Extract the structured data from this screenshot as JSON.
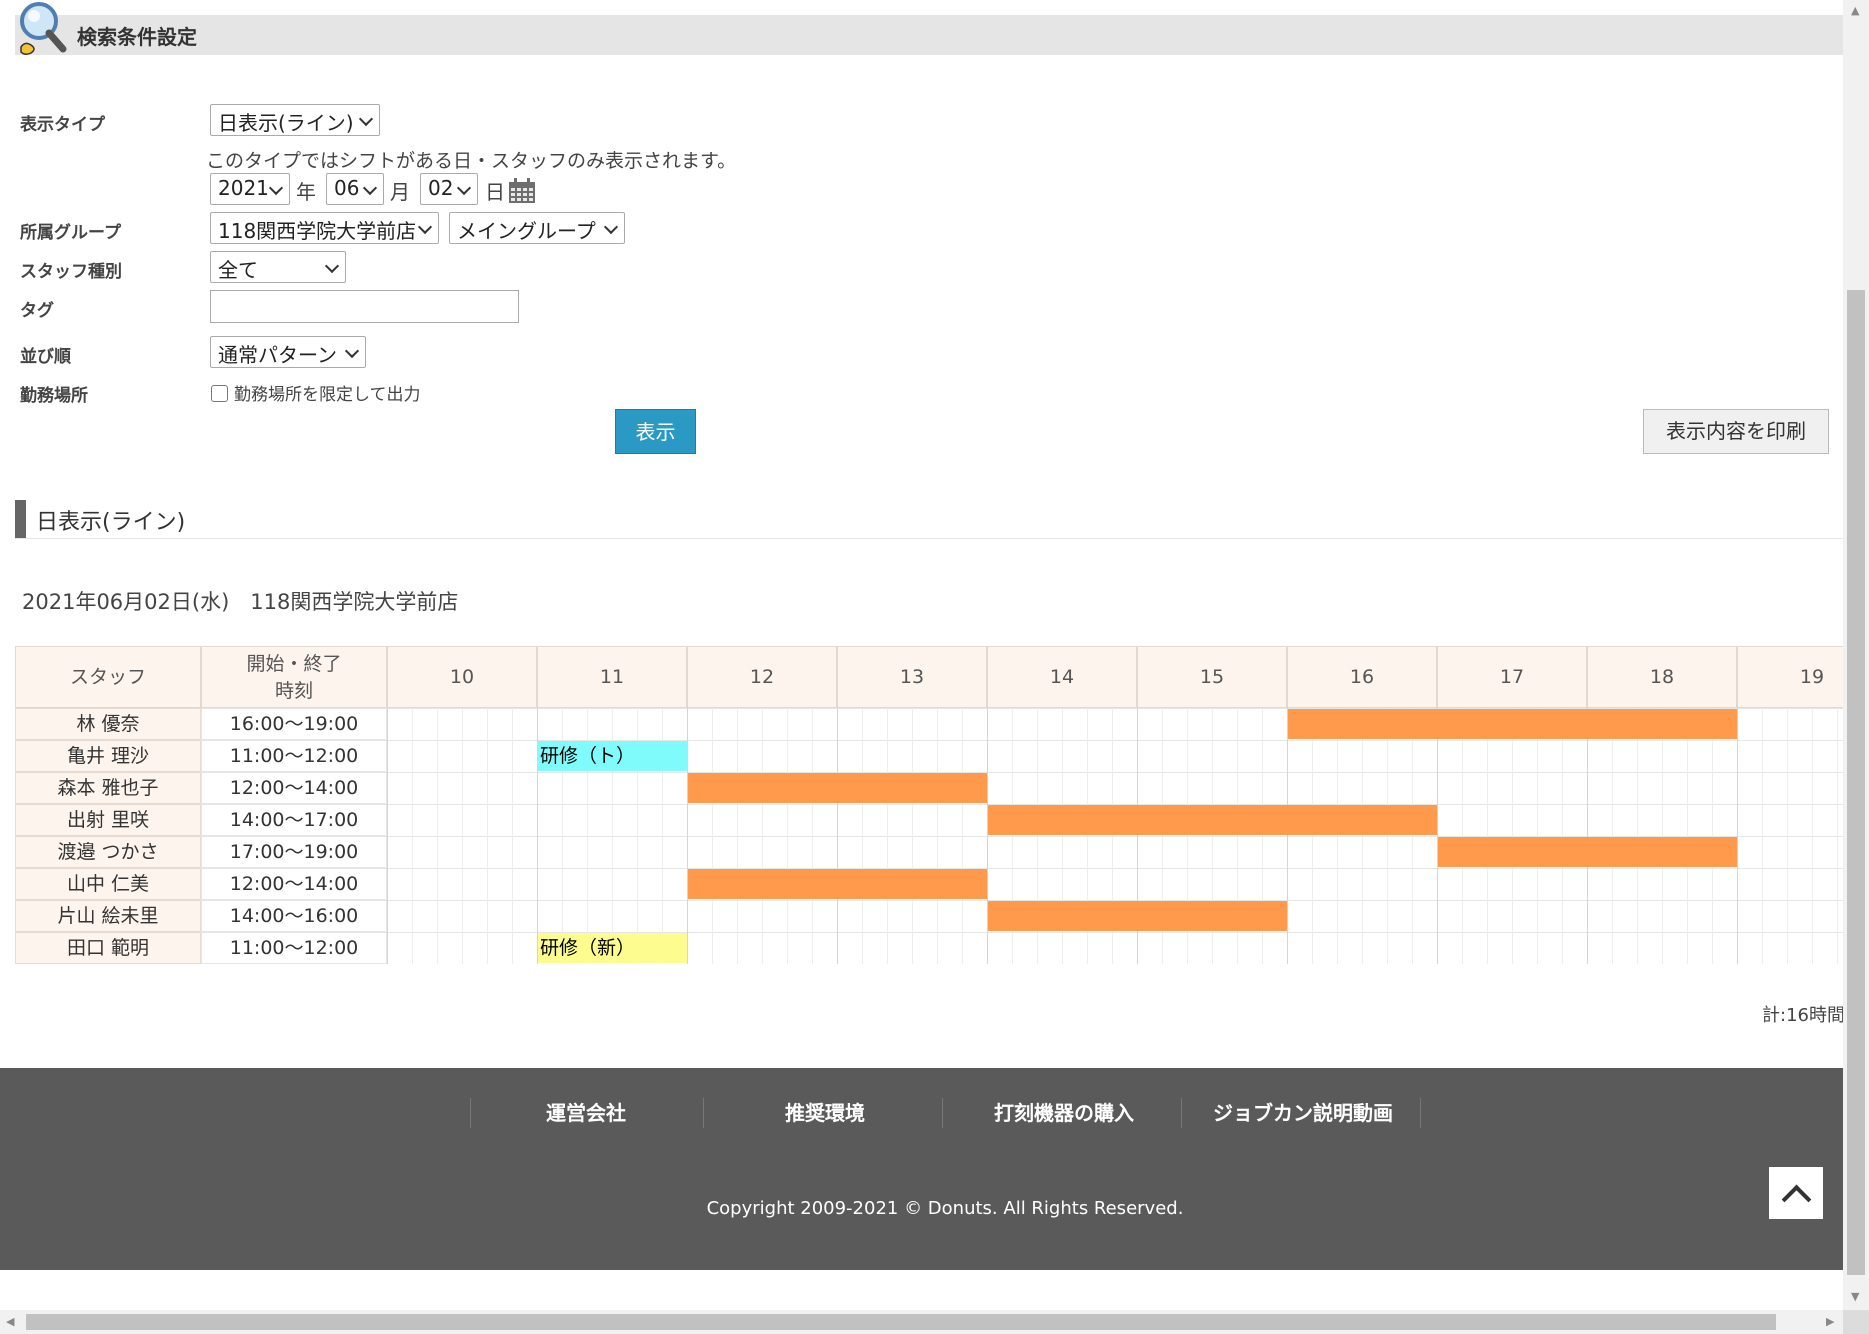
{
  "search_section": {
    "title": "検索条件設定"
  },
  "form": {
    "display_type_label": "表示タイプ",
    "display_type_value": "日表示(ライン)",
    "display_type_note": "このタイプではシフトがある日・スタッフのみ表示されます。",
    "year_value": "2021",
    "year_unit": "年",
    "month_value": "06",
    "month_unit": "月",
    "day_value": "02",
    "day_unit": "日",
    "group_label": "所属グループ",
    "group_store_value": "118関西学院大学前店",
    "group_sub_value": "メイングループ",
    "staff_type_label": "スタッフ種別",
    "staff_type_value": "全て",
    "tag_label": "タグ",
    "tag_value": "",
    "order_label": "並び順",
    "order_value": "通常パターン",
    "workplace_label": "勤務場所",
    "workplace_checkbox_label": "勤務場所を限定して出力",
    "show_button": "表示",
    "print_button": "表示内容を印刷"
  },
  "result_section": {
    "title": "日表示(ライン)",
    "date_store": "2021年06月02日(水)　118関西学院大学前店"
  },
  "table": {
    "col_staff": "スタッフ",
    "col_time_1": "開始・終了",
    "col_time_2": "時刻",
    "hours": [
      "10",
      "11",
      "12",
      "13",
      "14",
      "15",
      "16",
      "17",
      "18",
      "19"
    ],
    "rows": [
      {
        "name": "林 優奈",
        "time": "16:00〜19:00",
        "start": 16,
        "end": 19,
        "label": "",
        "color": "#ff9a4d"
      },
      {
        "name": "亀井 理沙",
        "time": "11:00〜12:00",
        "start": 11,
        "end": 12,
        "label": "研修（ト）",
        "color": "#7ffbfc"
      },
      {
        "name": "森本 雅也子",
        "time": "12:00〜14:00",
        "start": 12,
        "end": 14,
        "label": "",
        "color": "#ff9a4d"
      },
      {
        "name": "出射 里咲",
        "time": "14:00〜17:00",
        "start": 14,
        "end": 17,
        "label": "",
        "color": "#ff9a4d"
      },
      {
        "name": "渡邉 つかさ",
        "time": "17:00〜19:00",
        "start": 17,
        "end": 19,
        "label": "",
        "color": "#ff9a4d"
      },
      {
        "name": "山中 仁美",
        "time": "12:00〜14:00",
        "start": 12,
        "end": 14,
        "label": "",
        "color": "#ff9a4d"
      },
      {
        "name": "片山 絵未里",
        "time": "14:00〜16:00",
        "start": 14,
        "end": 16,
        "label": "",
        "color": "#ff9a4d"
      },
      {
        "name": "田口 範明",
        "time": "11:00〜12:00",
        "start": 11,
        "end": 12,
        "label": "研修（新）",
        "color": "#fdfd8f"
      }
    ],
    "total": "計:16時間"
  },
  "footer": {
    "links": [
      "運営会社",
      "推奨環境",
      "打刻機器の購入",
      "ジョブカン説明動画"
    ],
    "copyright": "Copyright 2009-2021 © Donuts. All Rights Reserved."
  },
  "icons": {
    "search": "magnifier-icon",
    "calendar": "calendar-icon",
    "top": "chevron-up-icon"
  }
}
